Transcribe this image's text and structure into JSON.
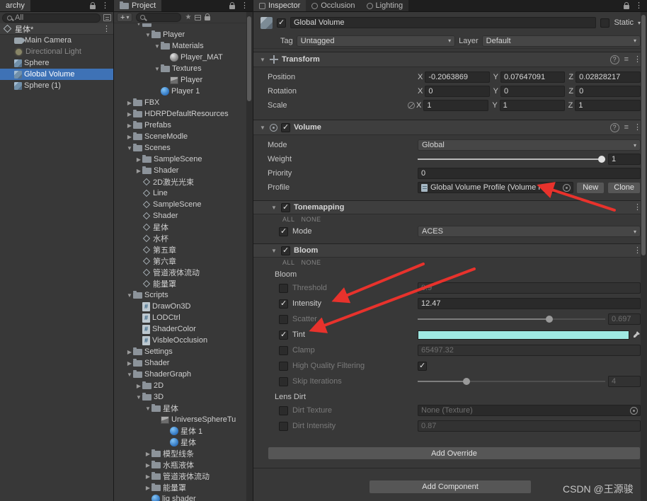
{
  "watermark": "CSDN @王源骏",
  "hierarchy": {
    "tab_title": "archy",
    "search_value": "All",
    "scene_row": {
      "label": "星体*"
    },
    "items": [
      {
        "label": "Main Camera",
        "icon": "camera",
        "indent": 1
      },
      {
        "label": "Directional Light",
        "icon": "light",
        "indent": 1,
        "disabled": true
      },
      {
        "label": "Sphere",
        "icon": "gameobject",
        "indent": 1
      },
      {
        "label": "Global Volume",
        "icon": "gameobject",
        "indent": 1,
        "selected": true
      },
      {
        "label": "Sphere (1)",
        "icon": "gameobject",
        "indent": 1
      }
    ]
  },
  "project": {
    "tab_title": "Project",
    "items": [
      {
        "label": "",
        "icon": "folder",
        "indent": 2,
        "arrow": "open"
      },
      {
        "label": "Player",
        "icon": "folder",
        "indent": 3,
        "arrow": "open"
      },
      {
        "label": "Materials",
        "icon": "folder",
        "indent": 4,
        "arrow": "open"
      },
      {
        "label": "Player_MAT",
        "icon": "material",
        "indent": 5,
        "arrow": "none"
      },
      {
        "label": "Textures",
        "icon": "folder",
        "indent": 4,
        "arrow": "open"
      },
      {
        "label": "Player",
        "icon": "texture",
        "indent": 5,
        "arrow": "none"
      },
      {
        "label": "Player 1",
        "icon": "asset-blue",
        "indent": 4,
        "arrow": "none"
      },
      {
        "label": "FBX",
        "icon": "folder",
        "indent": 1,
        "arrow": "closed"
      },
      {
        "label": "HDRPDefaultResources",
        "icon": "folder",
        "indent": 1,
        "arrow": "closed"
      },
      {
        "label": "Prefabs",
        "icon": "folder",
        "indent": 1,
        "arrow": "closed"
      },
      {
        "label": "SceneModle",
        "icon": "folder",
        "indent": 1,
        "arrow": "closed"
      },
      {
        "label": "Scenes",
        "icon": "folder",
        "indent": 1,
        "arrow": "open"
      },
      {
        "label": "SampleScene",
        "icon": "folder",
        "indent": 2,
        "arrow": "closed"
      },
      {
        "label": "Shader",
        "icon": "folder",
        "indent": 2,
        "arrow": "closed"
      },
      {
        "label": "2D激光光束",
        "icon": "unity-scene",
        "indent": 2,
        "arrow": "none"
      },
      {
        "label": "Line",
        "icon": "unity-scene",
        "indent": 2,
        "arrow": "none"
      },
      {
        "label": "SampleScene",
        "icon": "unity-scene",
        "indent": 2,
        "arrow": "none"
      },
      {
        "label": "Shader",
        "icon": "unity-scene",
        "indent": 2,
        "arrow": "none"
      },
      {
        "label": "星体",
        "icon": "unity-scene",
        "indent": 2,
        "arrow": "none"
      },
      {
        "label": "水杯",
        "icon": "unity-scene",
        "indent": 2,
        "arrow": "none"
      },
      {
        "label": "第五章",
        "icon": "unity-scene",
        "indent": 2,
        "arrow": "none"
      },
      {
        "label": "第六章",
        "icon": "unity-scene",
        "indent": 2,
        "arrow": "none"
      },
      {
        "label": "管道液体流动",
        "icon": "unity-scene",
        "indent": 2,
        "arrow": "none"
      },
      {
        "label": "能量罩",
        "icon": "unity-scene",
        "indent": 2,
        "arrow": "none"
      },
      {
        "label": "Scripts",
        "icon": "folder",
        "indent": 1,
        "arrow": "open"
      },
      {
        "label": "DrawOn3D",
        "icon": "script",
        "indent": 2,
        "arrow": "none"
      },
      {
        "label": "LODCtrl",
        "icon": "script",
        "indent": 2,
        "arrow": "none"
      },
      {
        "label": "ShaderColor",
        "icon": "script",
        "indent": 2,
        "arrow": "none"
      },
      {
        "label": "VisbleOcclusion",
        "icon": "script",
        "indent": 2,
        "arrow": "none"
      },
      {
        "label": "Settings",
        "icon": "folder",
        "indent": 1,
        "arrow": "closed"
      },
      {
        "label": "Shader",
        "icon": "folder",
        "indent": 1,
        "arrow": "closed"
      },
      {
        "label": "ShaderGraph",
        "icon": "folder",
        "indent": 1,
        "arrow": "open"
      },
      {
        "label": "2D",
        "icon": "folder",
        "indent": 2,
        "arrow": "closed"
      },
      {
        "label": "3D",
        "icon": "folder",
        "indent": 2,
        "arrow": "open"
      },
      {
        "label": "星体",
        "icon": "folder",
        "indent": 3,
        "arrow": "open"
      },
      {
        "label": "UniverseSphereTu",
        "icon": "texture",
        "indent": 4,
        "arrow": "none"
      },
      {
        "label": "星体 1",
        "icon": "asset-blue",
        "indent": 5,
        "arrow": "none"
      },
      {
        "label": "星体",
        "icon": "asset-blue",
        "indent": 5,
        "arrow": "none"
      },
      {
        "label": "模型线条",
        "icon": "folder",
        "indent": 3,
        "arrow": "closed"
      },
      {
        "label": "水瓶液体",
        "icon": "folder",
        "indent": 3,
        "arrow": "closed"
      },
      {
        "label": "管道液体流动",
        "icon": "folder",
        "indent": 3,
        "arrow": "closed"
      },
      {
        "label": "能量罩",
        "icon": "folder",
        "indent": 3,
        "arrow": "closed"
      },
      {
        "label": "liq shader",
        "icon": "asset-blue",
        "indent": 3,
        "arrow": "none"
      }
    ]
  },
  "inspector": {
    "tabs": [
      {
        "label": "Inspector"
      },
      {
        "label": "Occlusion"
      },
      {
        "label": "Lighting"
      }
    ],
    "game_object": {
      "name": "Global Volume",
      "static_label": "Static"
    },
    "tag_layer": {
      "tag_label": "Tag",
      "tag_value": "Untagged",
      "layer_label": "Layer",
      "layer_value": "Default"
    },
    "transform": {
      "title": "Transform",
      "axis": {
        "x": "X",
        "y": "Y",
        "z": "Z"
      },
      "position": {
        "label": "Position",
        "x": "-0.2063869",
        "y": "0.07647091",
        "z": "0.02828217"
      },
      "rotation": {
        "label": "Rotation",
        "x": "0",
        "y": "0",
        "z": "0"
      },
      "scale": {
        "label": "Scale",
        "x": "1",
        "y": "1",
        "z": "1"
      }
    },
    "volume": {
      "title": "Volume",
      "mode_label": "Mode",
      "mode_value": "Global",
      "weight_label": "Weight",
      "weight_value": "1",
      "priority_label": "Priority",
      "priority_value": "0",
      "profile_label": "Profile",
      "profile_value": "Global Volume Profile (Volume Prof",
      "new_label": "New",
      "clone_label": "Clone"
    },
    "tonemapping": {
      "title": "Tonemapping",
      "all_label": "ALL",
      "none_label": "NONE",
      "mode_label": "Mode",
      "mode_value": "ACES"
    },
    "bloom": {
      "title": "Bloom",
      "all_label": "ALL",
      "none_label": "NONE",
      "bloom_section_label": "Bloom",
      "lens_dirt_section_label": "Lens Dirt",
      "threshold": {
        "label": "Threshold",
        "value": "0.9"
      },
      "intensity": {
        "label": "Intensity",
        "value": "12.47"
      },
      "scatter": {
        "label": "Scatter",
        "value": "0.697"
      },
      "tint": {
        "label": "Tint",
        "color": "#9FE8E2"
      },
      "clamp": {
        "label": "Clamp",
        "value": "65497.32"
      },
      "hqf": {
        "label": "High Quality Filtering"
      },
      "skip": {
        "label": "Skip Iterations",
        "value": "4"
      },
      "dirt_texture": {
        "label": "Dirt Texture",
        "value": "None (Texture)"
      },
      "dirt_intensity": {
        "label": "Dirt Intensity",
        "value": "0.87"
      }
    },
    "add_override_label": "Add Override",
    "add_component_label": "Add Component"
  }
}
